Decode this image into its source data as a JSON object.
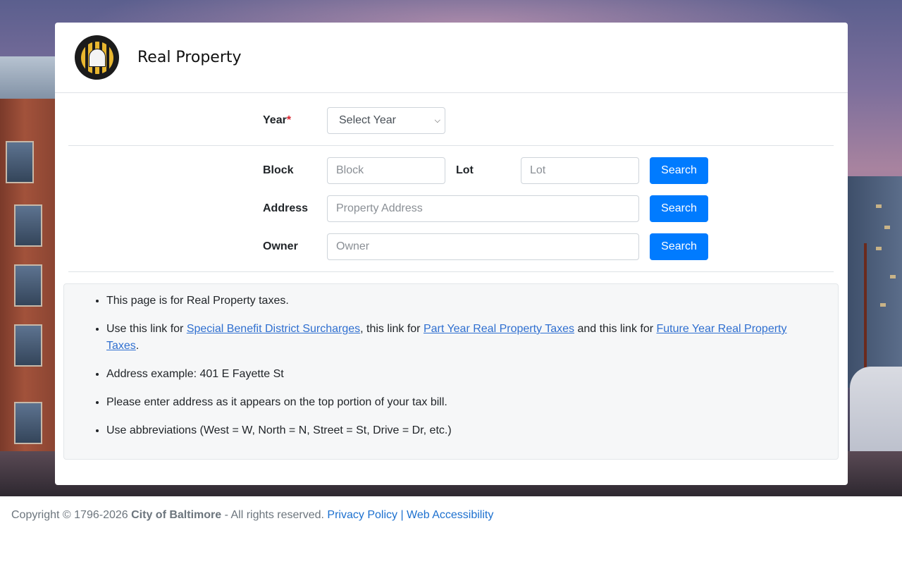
{
  "header": {
    "title": "Real Property",
    "logo_name": "department-of-finance-seal"
  },
  "form": {
    "year_label": "Year",
    "year_required_mark": "*",
    "year_select_value": "Select Year",
    "block_label": "Block",
    "block_placeholder": "Block",
    "lot_label": "Lot",
    "lot_placeholder": "Lot",
    "address_label": "Address",
    "address_placeholder": "Property Address",
    "owner_label": "Owner",
    "owner_placeholder": "Owner",
    "search_label": "Search"
  },
  "info": {
    "item1": "This page is for Real Property taxes.",
    "item2_prefix": "Use this link for ",
    "item2_link1": "Special Benefit District Surcharges",
    "item2_mid1": ", this link for ",
    "item2_link2": "Part Year Real Property Taxes",
    "item2_mid2": " and this link for ",
    "item2_link3": "Future Year Real Property Taxes",
    "item2_suffix": ".",
    "item3": "Address example: 401 E Fayette St",
    "item4": "Please enter address as it appears on the top portion of your tax bill.",
    "item5": "Use abbreviations (West = W, North = N, Street = St, Drive = Dr, etc.)"
  },
  "footer": {
    "copyright": "Copyright © 1796-2026 ",
    "org": "City of Baltimore",
    "rights": " - All rights reserved. ",
    "privacy": "Privacy Policy",
    "separator": " | ",
    "accessibility": "Web Accessibility"
  },
  "colors": {
    "primary": "#007bff",
    "link": "#2f6fd0",
    "required": "#d9232e"
  }
}
